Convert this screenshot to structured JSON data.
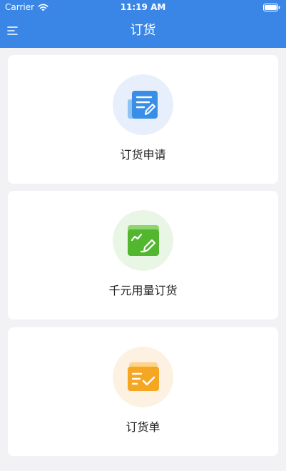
{
  "status_bar": {
    "carrier": "Carrier",
    "time": "11:19 AM"
  },
  "nav": {
    "title": "订货"
  },
  "menu_cards": [
    {
      "label": "订货申请",
      "icon": "order-request-icon",
      "accent": "#3a8ee6"
    },
    {
      "label": "千元用量订货",
      "icon": "usage-order-icon",
      "accent": "#52b62f"
    },
    {
      "label": "订货单",
      "icon": "order-list-icon",
      "accent": "#f5a623"
    }
  ],
  "colors": {
    "header": "#3a86e7",
    "background": "#f2f2f4"
  }
}
